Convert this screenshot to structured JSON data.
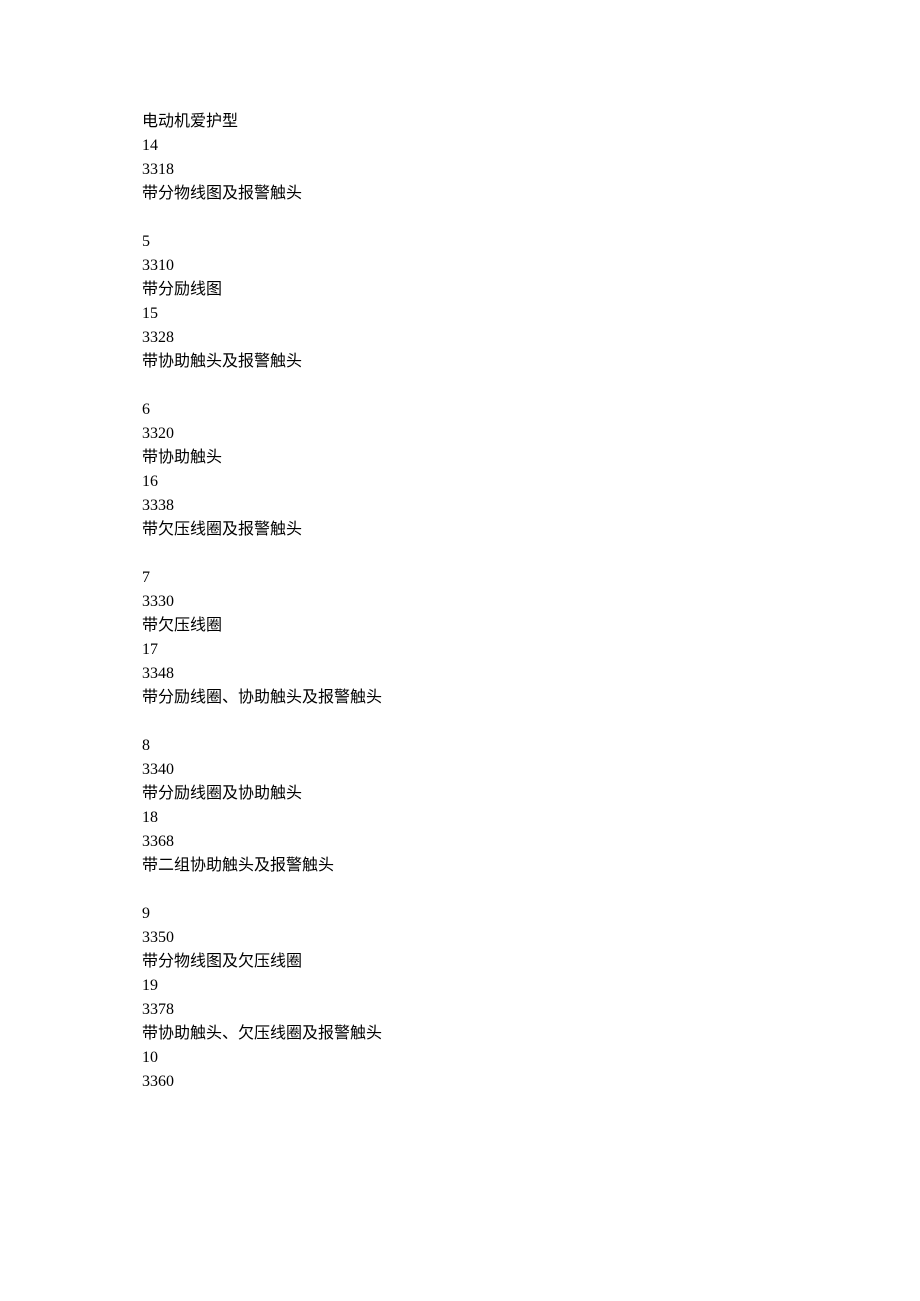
{
  "blocks": [
    {
      "lines": [
        "电动机爱护型",
        "14",
        "3318",
        "带分物线图及报警触头"
      ]
    },
    {
      "lines": [
        "5",
        "3310",
        "带分励线图",
        "15",
        "3328",
        "带协助触头及报警触头"
      ]
    },
    {
      "lines": [
        "6",
        "3320",
        "带协助触头",
        "16",
        "3338",
        "带欠压线圈及报警触头"
      ]
    },
    {
      "lines": [
        "7",
        "3330",
        "带欠压线圈",
        "17",
        "3348",
        "带分励线圈、协助触头及报警触头"
      ]
    },
    {
      "lines": [
        "8",
        "3340",
        "带分励线圈及协助触头",
        "18",
        "3368",
        "带二组协助触头及报警触头"
      ]
    },
    {
      "lines": [
        "9",
        "3350",
        "带分物线图及欠压线圈",
        "19",
        "3378",
        "带协助触头、欠压线圈及报警触头",
        "10",
        "3360"
      ]
    }
  ]
}
